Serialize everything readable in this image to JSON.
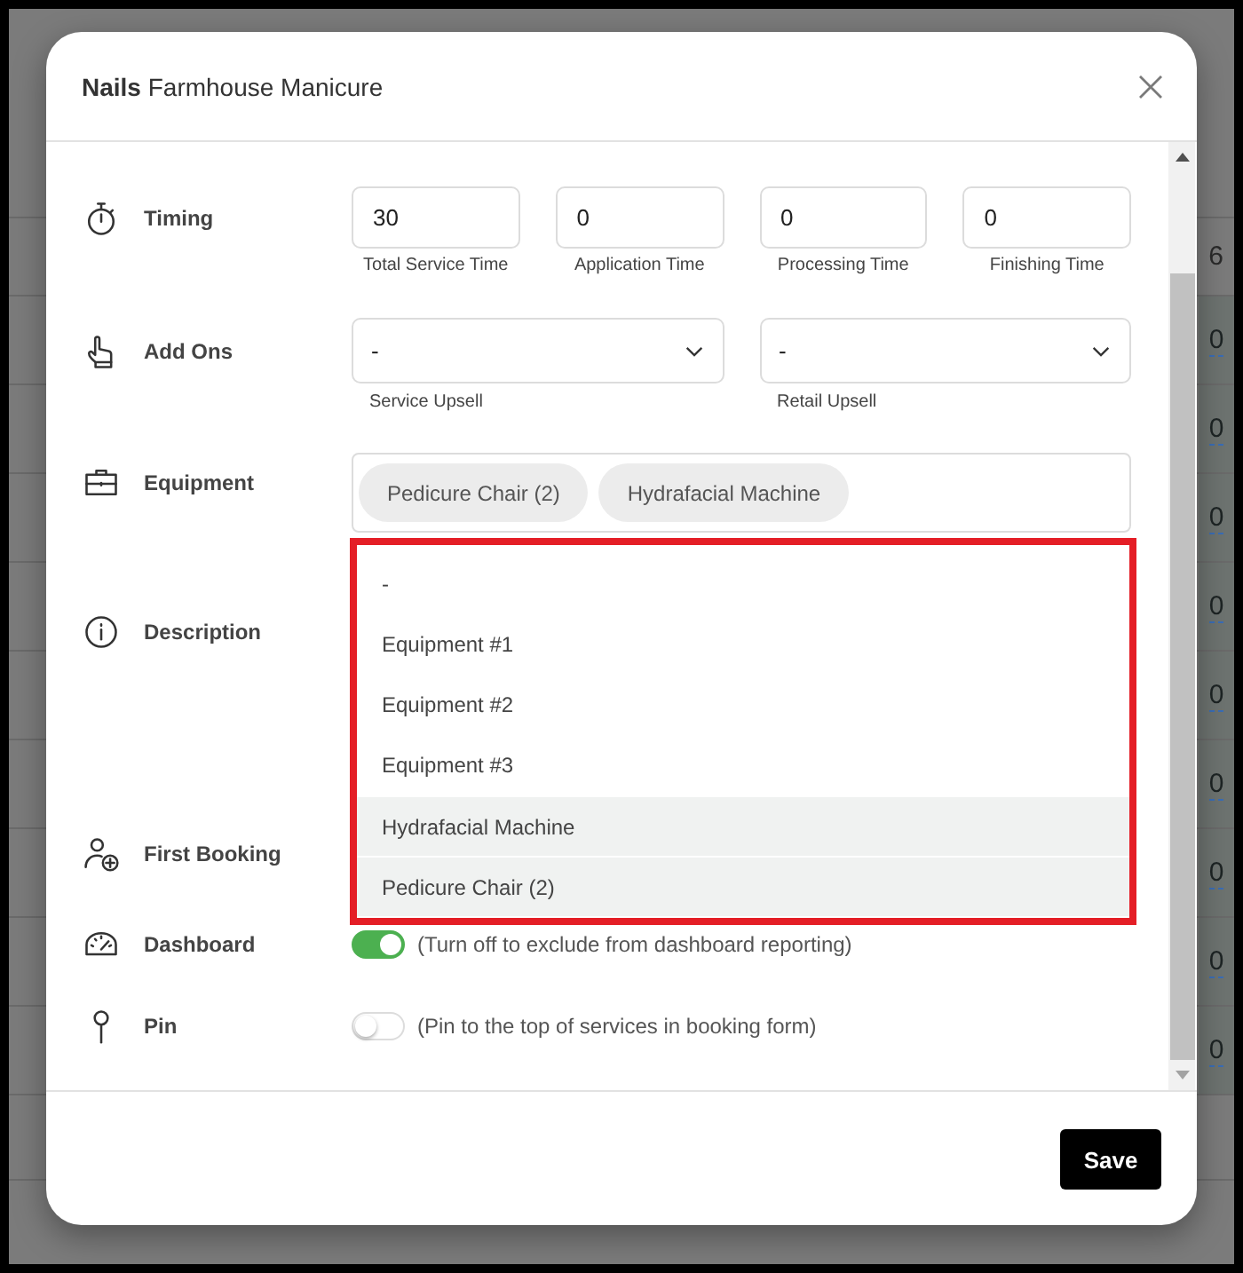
{
  "dialog": {
    "title": "**Nails** Farmhouse Manicure"
  },
  "sections": [
    {
      "kind": "timing",
      "label": "Timing",
      "fields": [
        {
          "value": "30",
          "caption": "Total Service Time"
        },
        {
          "value": "0",
          "caption": "Application Time"
        },
        {
          "value": "0",
          "caption": "Processing Time"
        },
        {
          "value": "0",
          "caption": "Finishing Time"
        }
      ]
    },
    {
      "kind": "selects",
      "label": "Add Ons",
      "fields": [
        {
          "value": "-",
          "caption": "Service Upsell"
        },
        {
          "value": "-",
          "caption": "Retail Upsell"
        }
      ]
    },
    {
      "kind": "tags",
      "label": "Equipment",
      "tags": [
        "Pedicure Chair (2)",
        "Hydrafacial Machine"
      ],
      "dropdown": {
        "options": [
          {
            "label": "-",
            "selected": false
          },
          {
            "label": "Equipment #1",
            "selected": false
          },
          {
            "label": "Equipment #2",
            "selected": false
          },
          {
            "label": "Equipment #3",
            "selected": false
          },
          {
            "label": "Hydrafacial Machine",
            "selected": true
          },
          {
            "label": "Pedicure Chair (2)",
            "selected": true
          }
        ]
      }
    },
    {
      "kind": "blank",
      "label": "Description"
    },
    {
      "kind": "blank",
      "label": "First Booking"
    },
    {
      "kind": "toggle",
      "label": "Dashboard",
      "on": true,
      "note": "(Turn off to exclude from dashboard reporting)"
    },
    {
      "kind": "toggle",
      "label": "Pin",
      "on": false,
      "note": "(Pin to the top of services in booking form)"
    }
  ],
  "footer": {
    "save_button": "Save"
  },
  "background_table": {
    "rows": [
      {
        "kind": "count",
        "text": "6"
      },
      {
        "kind": "link",
        "text": "0"
      },
      {
        "kind": "link",
        "text": "0"
      },
      {
        "kind": "link",
        "text": "0"
      },
      {
        "kind": "link",
        "text": "0"
      },
      {
        "kind": "link",
        "text": "0"
      },
      {
        "kind": "link",
        "text": "0"
      },
      {
        "kind": "link",
        "text": "0"
      },
      {
        "kind": "link",
        "text": "0"
      },
      {
        "kind": "link",
        "text": "0"
      }
    ]
  }
}
